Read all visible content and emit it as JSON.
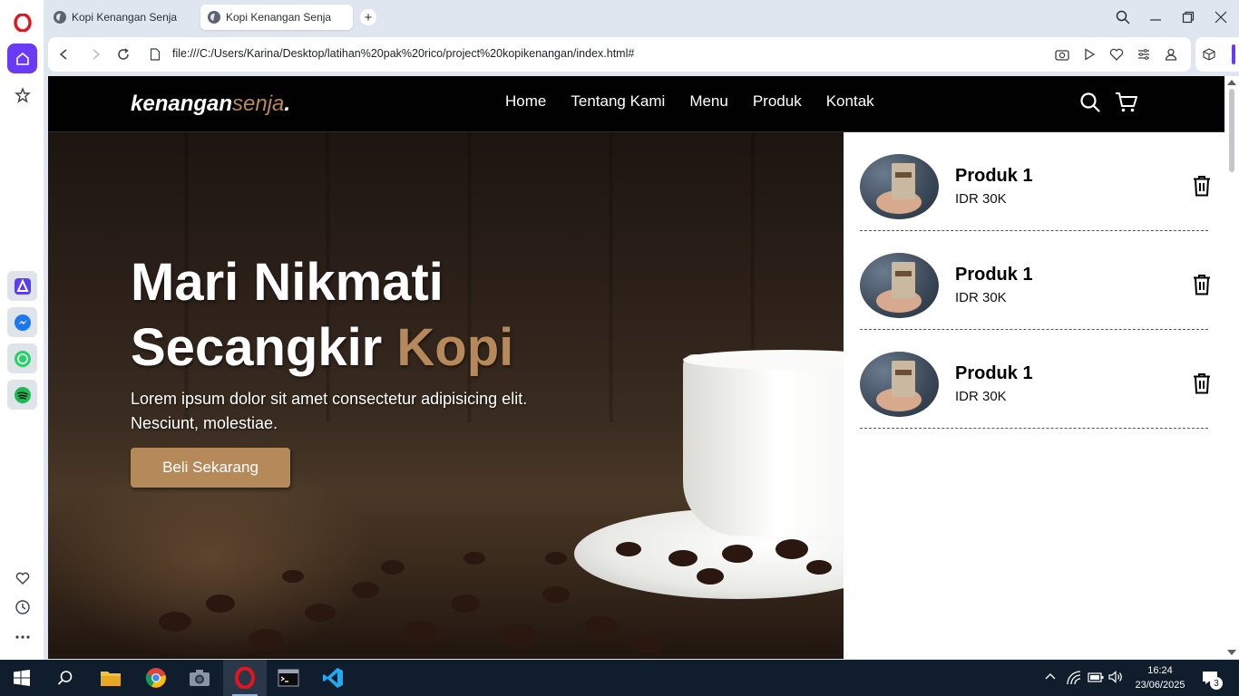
{
  "browser": {
    "tabs": [
      {
        "title": "Kopi Kenangan Senja",
        "active": false
      },
      {
        "title": "Kopi Kenangan Senja",
        "active": true
      }
    ],
    "url": "file:///C:/Users/Karina/Desktop/latihan%20pak%20rico/project%20kopikenangan/index.html#",
    "accent_color": "#6a3bf5"
  },
  "site": {
    "logo": {
      "main": "kenangan",
      "accent": "senja",
      "dot": "."
    },
    "menu": [
      "Home",
      "Tentang Kami",
      "Menu",
      "Produk",
      "Kontak"
    ],
    "hero": {
      "title_line1": "Mari Nikmati",
      "title_line2_main": "Secangkir ",
      "title_line2_accent": "Kopi",
      "text": "Lorem ipsum dolor sit amet consectetur adipisicing elit. Nesciunt, molestiae.",
      "cta": "Beli Sekarang"
    },
    "accent_color": "#b6895b",
    "cart": [
      {
        "name": "Produk 1",
        "price": "IDR 30K"
      },
      {
        "name": "Produk 1",
        "price": "IDR 30K"
      },
      {
        "name": "Produk 1",
        "price": "IDR 30K"
      }
    ]
  },
  "taskbar": {
    "time": "16:24",
    "date": "23/06/2025",
    "notifications": "3"
  }
}
